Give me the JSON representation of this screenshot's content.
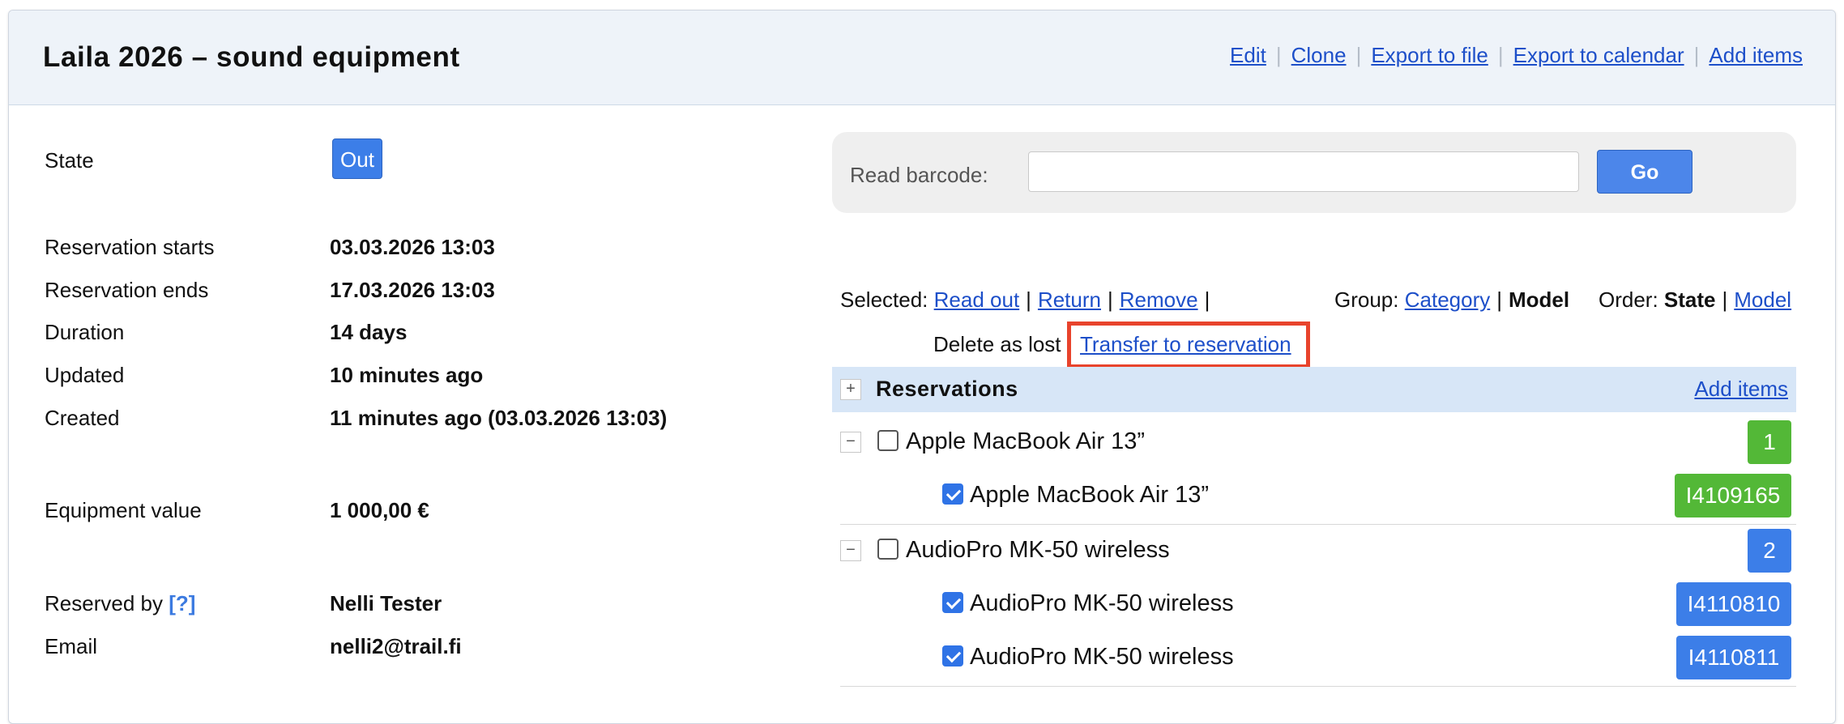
{
  "header": {
    "title": "Laila 2026 – sound equipment",
    "actions": [
      "Edit",
      "Clone",
      "Export to file",
      "Export to calendar",
      "Add items"
    ]
  },
  "details": {
    "state_label": "State",
    "state_value": "Out",
    "starts_label": "Reservation starts",
    "starts_value": "03.03.2026 13:03",
    "ends_label": "Reservation ends",
    "ends_value": "17.03.2026 13:03",
    "duration_label": "Duration",
    "duration_value": "14 days",
    "updated_label": "Updated",
    "updated_value": "10 minutes ago",
    "created_label": "Created",
    "created_value": "11 minutes ago (03.03.2026 13:03)",
    "equipment_label": "Equipment value",
    "equipment_value": "1 000,00 €",
    "reserved_by_label": "Reserved by",
    "reserved_by_help": "[?]",
    "reserved_by_value": "Nelli Tester",
    "email_label": "Email",
    "email_value": "nelli2@trail.fi"
  },
  "barcode": {
    "label": "Read barcode:",
    "value": "",
    "button": "Go"
  },
  "toolbar": {
    "selected_label": "Selected:",
    "read_out": "Read out",
    "return": "Return",
    "remove": "Remove",
    "delete_lost": "Delete as lost",
    "transfer": "Transfer to reservation",
    "group_label": "Group:",
    "group_category": "Category",
    "group_model": "Model",
    "order_label": "Order:",
    "order_state": "State",
    "order_model": "Model",
    "pipe": "|"
  },
  "reservations": {
    "title": "Reservations",
    "add_items": "Add items",
    "expand_symbol": "+",
    "collapse_symbol": "−",
    "groups": [
      {
        "name": "Apple MacBook Air 13”",
        "count": "1",
        "count_color": "#53b837",
        "items": [
          {
            "name": "Apple MacBook Air 13”",
            "code": "I4109165",
            "code_color": "#53b837",
            "checked": true
          }
        ]
      },
      {
        "name": "AudioPro MK-50 wireless",
        "count": "2",
        "count_color": "#3c7ee8",
        "items": [
          {
            "name": "AudioPro MK-50 wireless",
            "code": "I4110810",
            "code_color": "#3c7ee8",
            "checked": true
          },
          {
            "name": "AudioPro MK-50 wireless",
            "code": "I4110811",
            "code_color": "#3c7ee8",
            "checked": true
          }
        ]
      }
    ]
  }
}
